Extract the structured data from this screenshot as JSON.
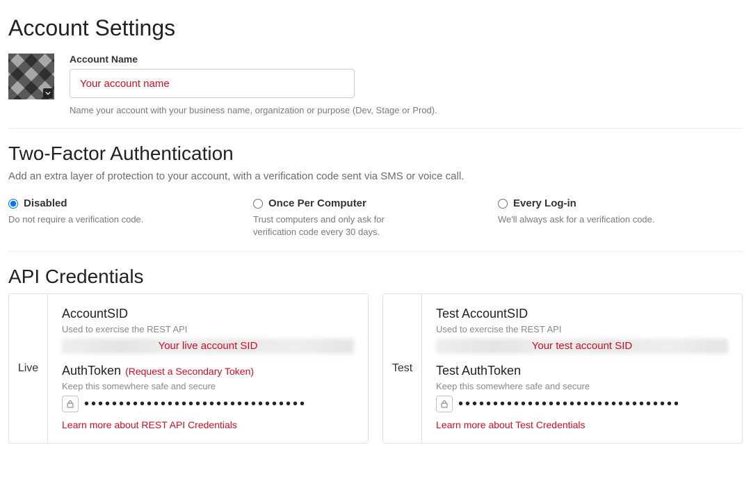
{
  "page": {
    "title": "Account Settings"
  },
  "account": {
    "name_label": "Account Name",
    "name_placeholder": "Your account name",
    "name_value": "",
    "help": "Name your account with your business name, organization or purpose (Dev, Stage or Prod)."
  },
  "tfa": {
    "title": "Two-Factor Authentication",
    "desc": "Add an extra layer of protection to your account, with a verification code sent via SMS or voice call.",
    "options": [
      {
        "label": "Disabled",
        "desc": "Do not require a verification code.",
        "selected": true
      },
      {
        "label": "Once Per Computer",
        "desc": "Trust computers and only ask for verification code every 30 days.",
        "selected": false
      },
      {
        "label": "Every Log-in",
        "desc": "We'll always ask for a verification code.",
        "selected": false
      }
    ]
  },
  "api": {
    "title": "API Credentials",
    "live": {
      "side": "Live",
      "sid_label": "AccountSID",
      "sid_sub": "Used to exercise the REST API",
      "sid_overlay": "Your live account SID",
      "token_label": "AuthToken",
      "secondary_link": "(Request a Secondary Token)",
      "token_sub": "Keep this somewhere safe and secure",
      "token_mask": "••••••••••••••••••••••••••••••••",
      "learn": "Learn more about REST API Credentials"
    },
    "test": {
      "side": "Test",
      "sid_label": "Test AccountSID",
      "sid_sub": "Used to exercise the REST API",
      "sid_overlay": "Your test account SID",
      "token_label": "Test AuthToken",
      "token_sub": "Keep this somewhere safe and secure",
      "token_mask": "••••••••••••••••••••••••••••••••",
      "learn": "Learn more about Test Credentials"
    }
  }
}
